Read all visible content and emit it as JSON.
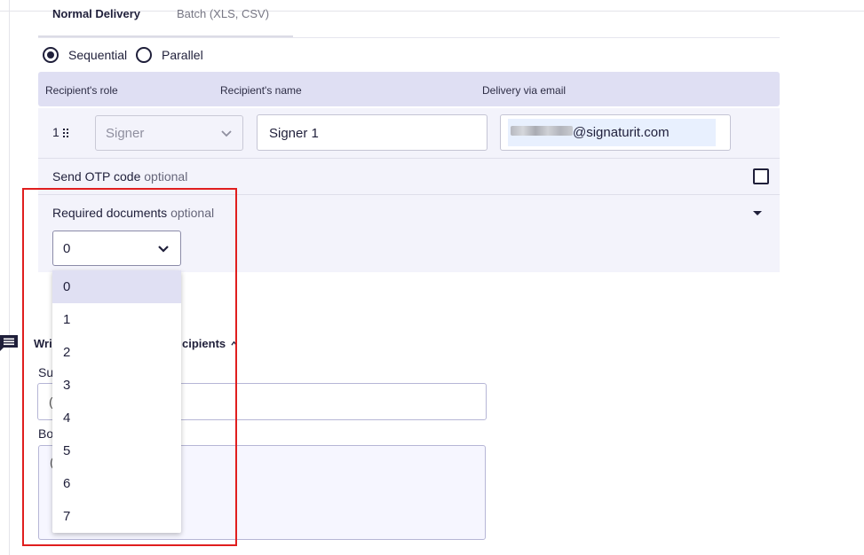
{
  "tabs": [
    {
      "label": "Normal Delivery",
      "active": true
    },
    {
      "label": "Batch (XLS, CSV)",
      "active": false
    }
  ],
  "order": {
    "options": [
      "Sequential",
      "Parallel"
    ],
    "selected": "Sequential"
  },
  "table_header": {
    "role": "Recipient's role",
    "name": "Recipient's name",
    "delivery": "Delivery via email"
  },
  "recipient": {
    "index": "1",
    "role_placeholder": "Signer",
    "name_value": "Signer 1",
    "email_visible": "@signaturit.com",
    "otp_label": "Send OTP code",
    "otp_optional": "optional",
    "otp_checked": false,
    "docs_label": "Required documents",
    "docs_optional": "optional",
    "docs_selected": "0"
  },
  "docs_dropdown": {
    "options": [
      "0",
      "1",
      "2",
      "3",
      "4",
      "5",
      "6",
      "7"
    ],
    "selected_index": 0
  },
  "message_section": {
    "title_start": "Wri",
    "title_end": "cipients",
    "subject_label_fragment": "Su",
    "subject_value_fragment": "(",
    "body_label_fragment": "Bo",
    "body_value_fragment": "("
  },
  "icons": {
    "comment": "comment-icon",
    "chevron": "chevron-down-icon",
    "drag": "drag-handle-icon",
    "caret": "caret-down-icon"
  },
  "colors": {
    "primary": "#1f1f3a",
    "header_bg": "#dfdff3",
    "panel_bg": "#f3f3fb",
    "highlight": "#e01e1e"
  }
}
